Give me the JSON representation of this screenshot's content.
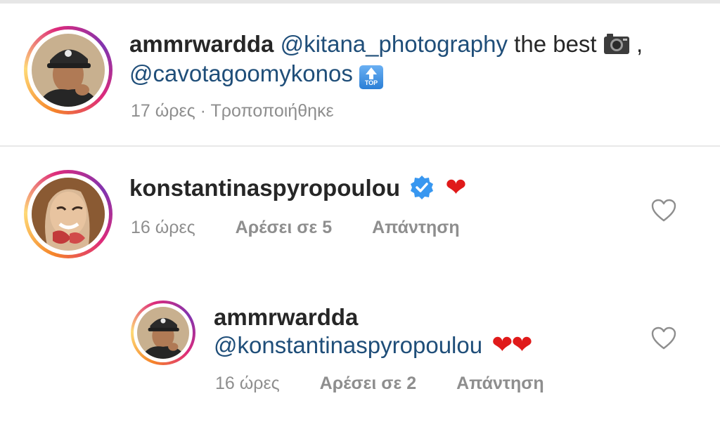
{
  "post_caption": {
    "username": "ammrwardda",
    "mention_1": "@kitana_photography",
    "text": "the best",
    "camera_icon": "camera-emoji",
    "separator": ",",
    "mention_2": "@cavotagoomykonos",
    "top_icon": "top-arrow-emoji",
    "top_label": "TOP",
    "time": "17 ώρες",
    "dot": "·",
    "edited": "Τροποποιήθηκε"
  },
  "comments": [
    {
      "username": "konstantinaspyropoulou",
      "verified_icon": "verified-badge-icon",
      "emoji": "❤",
      "time": "16 ώρες",
      "likes": "Αρέσει σε 5",
      "reply": "Απάντηση",
      "like_icon": "heart-outline-icon"
    },
    {
      "username": "ammrwardda",
      "mention": "@konstantinaspyropoulou",
      "emoji": "❤❤",
      "time": "16 ώρες",
      "likes": "Αρέσει σε 2",
      "reply": "Απάντηση",
      "like_icon": "heart-outline-icon"
    }
  ],
  "colors": {
    "mention": "#1f4e79",
    "meta_gray": "#8e8e8e",
    "heart_red": "#e01a1a",
    "verified_blue": "#3897f0"
  }
}
